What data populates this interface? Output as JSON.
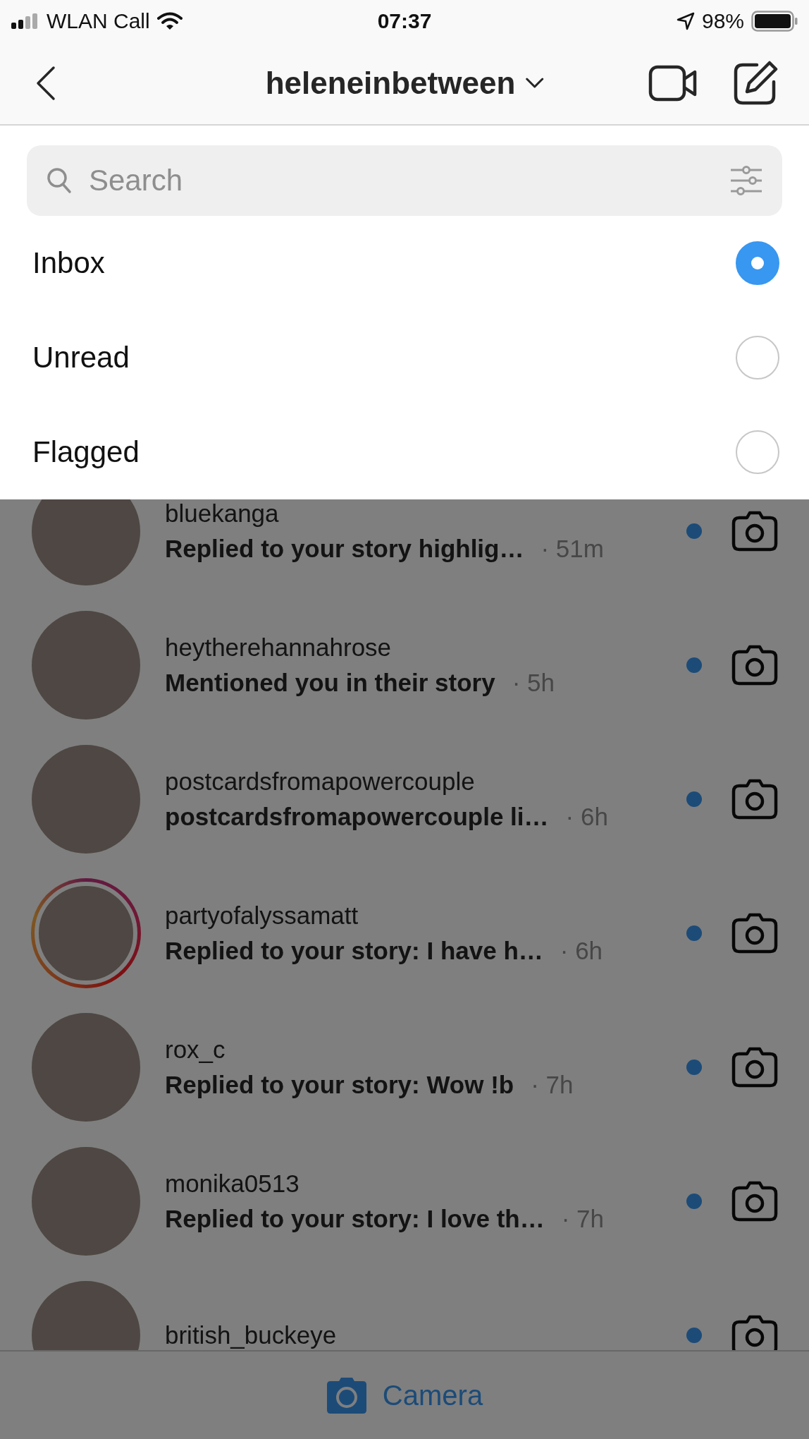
{
  "status_bar": {
    "carrier": "WLAN Call",
    "time": "07:37",
    "battery": "98%"
  },
  "header": {
    "title": "heleneinbetween"
  },
  "search": {
    "placeholder": "Search"
  },
  "filters": [
    {
      "label": "Inbox",
      "selected": true
    },
    {
      "label": "Unread",
      "selected": false
    },
    {
      "label": "Flagged",
      "selected": false
    }
  ],
  "threads": [
    {
      "username": "bluekanga",
      "message": "Replied to your story highlig…",
      "time": "· 51m",
      "unread": true,
      "story_ring": false
    },
    {
      "username": "heytherehannahrose",
      "message": "Mentioned you in their story",
      "time": "· 5h",
      "unread": true,
      "story_ring": false
    },
    {
      "username": "postcardsfromapowercouple",
      "message": "postcardsfromapowercouple li…",
      "time": "· 6h",
      "unread": true,
      "story_ring": false
    },
    {
      "username": "partyofalyssamatt",
      "message": "Replied to your story: I have h…",
      "time": "· 6h",
      "unread": true,
      "story_ring": true
    },
    {
      "username": "rox_c",
      "message": "Replied to your story: Wow !b",
      "time": "· 7h",
      "unread": true,
      "story_ring": false
    },
    {
      "username": "monika0513",
      "message": "Replied to your story: I love th…",
      "time": "· 7h",
      "unread": true,
      "story_ring": false
    },
    {
      "username": "british_buckeye",
      "unread": true,
      "story_ring": false
    }
  ],
  "bottom_bar": {
    "label": "Camera"
  }
}
